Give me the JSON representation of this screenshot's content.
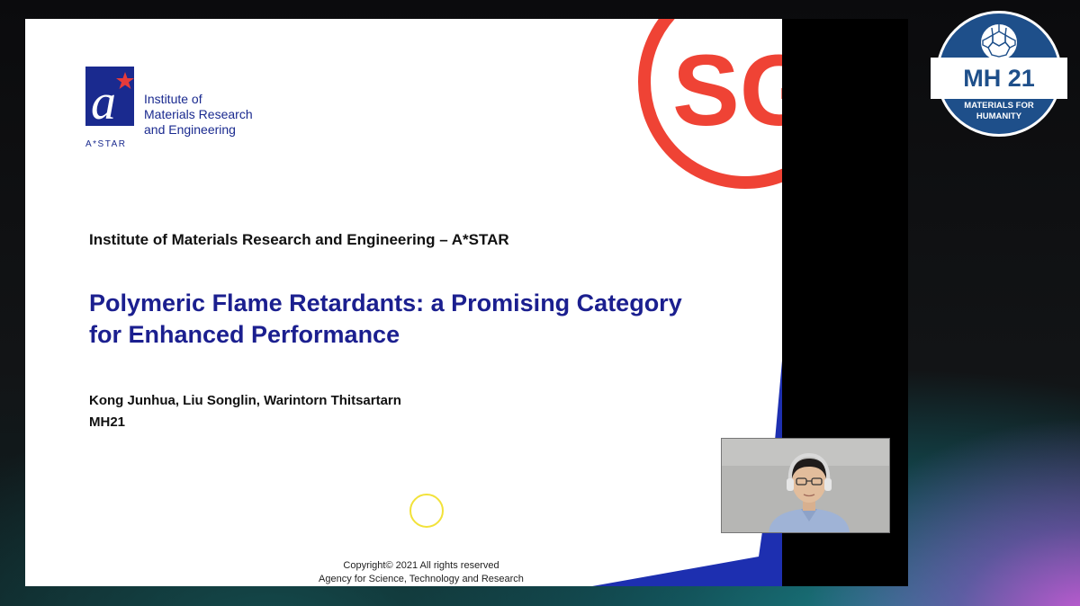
{
  "slide": {
    "logo": {
      "institute_lines": [
        "Institute of",
        "Materials Research",
        "and Engineering"
      ],
      "caption": "A*STAR"
    },
    "header": "Institute of Materials Research and Engineering – A*STAR",
    "title_lines": [
      "Polymeric Flame Retardants: a Promising Category",
      "for Enhanced Performance"
    ],
    "authors": "Kong Junhua, Liu Songlin, Warintorn Thitsartarn",
    "event": "MH21",
    "copyright_lines": [
      "Copyright© 2021 All rights reserved",
      "Agency for Science, Technology and Research"
    ],
    "sg_mark": "SG"
  },
  "badge": {
    "main": "MH 21",
    "sub_lines": [
      "MATERIALS FOR",
      "HUMANITY"
    ]
  },
  "colors": {
    "slide_blue": "#1b1f8f",
    "sg_red": "#ef4335",
    "badge_blue": "#1e4f8a",
    "wedge_blue": "#1d2fb0",
    "cursor_yellow": "#f2e23a"
  }
}
